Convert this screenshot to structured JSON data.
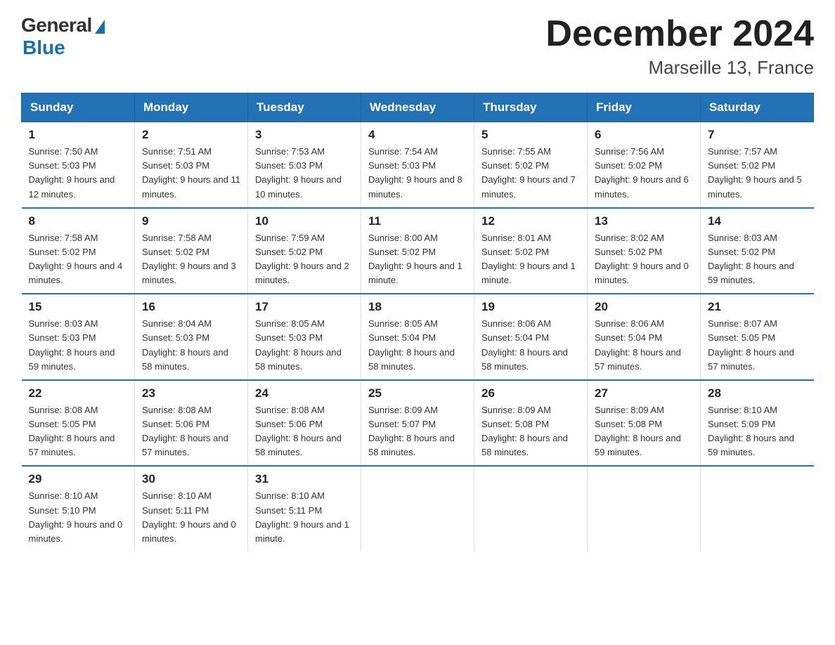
{
  "logo": {
    "general_text": "General",
    "blue_text": "Blue"
  },
  "title": "December 2024",
  "location": "Marseille 13, France",
  "weekdays": [
    "Sunday",
    "Monday",
    "Tuesday",
    "Wednesday",
    "Thursday",
    "Friday",
    "Saturday"
  ],
  "weeks": [
    [
      {
        "day": "1",
        "sunrise": "7:50 AM",
        "sunset": "5:03 PM",
        "daylight": "9 hours and 12 minutes."
      },
      {
        "day": "2",
        "sunrise": "7:51 AM",
        "sunset": "5:03 PM",
        "daylight": "9 hours and 11 minutes."
      },
      {
        "day": "3",
        "sunrise": "7:53 AM",
        "sunset": "5:03 PM",
        "daylight": "9 hours and 10 minutes."
      },
      {
        "day": "4",
        "sunrise": "7:54 AM",
        "sunset": "5:03 PM",
        "daylight": "9 hours and 8 minutes."
      },
      {
        "day": "5",
        "sunrise": "7:55 AM",
        "sunset": "5:02 PM",
        "daylight": "9 hours and 7 minutes."
      },
      {
        "day": "6",
        "sunrise": "7:56 AM",
        "sunset": "5:02 PM",
        "daylight": "9 hours and 6 minutes."
      },
      {
        "day": "7",
        "sunrise": "7:57 AM",
        "sunset": "5:02 PM",
        "daylight": "9 hours and 5 minutes."
      }
    ],
    [
      {
        "day": "8",
        "sunrise": "7:58 AM",
        "sunset": "5:02 PM",
        "daylight": "9 hours and 4 minutes."
      },
      {
        "day": "9",
        "sunrise": "7:58 AM",
        "sunset": "5:02 PM",
        "daylight": "9 hours and 3 minutes."
      },
      {
        "day": "10",
        "sunrise": "7:59 AM",
        "sunset": "5:02 PM",
        "daylight": "9 hours and 2 minutes."
      },
      {
        "day": "11",
        "sunrise": "8:00 AM",
        "sunset": "5:02 PM",
        "daylight": "9 hours and 1 minute."
      },
      {
        "day": "12",
        "sunrise": "8:01 AM",
        "sunset": "5:02 PM",
        "daylight": "9 hours and 1 minute."
      },
      {
        "day": "13",
        "sunrise": "8:02 AM",
        "sunset": "5:02 PM",
        "daylight": "9 hours and 0 minutes."
      },
      {
        "day": "14",
        "sunrise": "8:03 AM",
        "sunset": "5:02 PM",
        "daylight": "8 hours and 59 minutes."
      }
    ],
    [
      {
        "day": "15",
        "sunrise": "8:03 AM",
        "sunset": "5:03 PM",
        "daylight": "8 hours and 59 minutes."
      },
      {
        "day": "16",
        "sunrise": "8:04 AM",
        "sunset": "5:03 PM",
        "daylight": "8 hours and 58 minutes."
      },
      {
        "day": "17",
        "sunrise": "8:05 AM",
        "sunset": "5:03 PM",
        "daylight": "8 hours and 58 minutes."
      },
      {
        "day": "18",
        "sunrise": "8:05 AM",
        "sunset": "5:04 PM",
        "daylight": "8 hours and 58 minutes."
      },
      {
        "day": "19",
        "sunrise": "8:06 AM",
        "sunset": "5:04 PM",
        "daylight": "8 hours and 58 minutes."
      },
      {
        "day": "20",
        "sunrise": "8:06 AM",
        "sunset": "5:04 PM",
        "daylight": "8 hours and 57 minutes."
      },
      {
        "day": "21",
        "sunrise": "8:07 AM",
        "sunset": "5:05 PM",
        "daylight": "8 hours and 57 minutes."
      }
    ],
    [
      {
        "day": "22",
        "sunrise": "8:08 AM",
        "sunset": "5:05 PM",
        "daylight": "8 hours and 57 minutes."
      },
      {
        "day": "23",
        "sunrise": "8:08 AM",
        "sunset": "5:06 PM",
        "daylight": "8 hours and 57 minutes."
      },
      {
        "day": "24",
        "sunrise": "8:08 AM",
        "sunset": "5:06 PM",
        "daylight": "8 hours and 58 minutes."
      },
      {
        "day": "25",
        "sunrise": "8:09 AM",
        "sunset": "5:07 PM",
        "daylight": "8 hours and 58 minutes."
      },
      {
        "day": "26",
        "sunrise": "8:09 AM",
        "sunset": "5:08 PM",
        "daylight": "8 hours and 58 minutes."
      },
      {
        "day": "27",
        "sunrise": "8:09 AM",
        "sunset": "5:08 PM",
        "daylight": "8 hours and 59 minutes."
      },
      {
        "day": "28",
        "sunrise": "8:10 AM",
        "sunset": "5:09 PM",
        "daylight": "8 hours and 59 minutes."
      }
    ],
    [
      {
        "day": "29",
        "sunrise": "8:10 AM",
        "sunset": "5:10 PM",
        "daylight": "9 hours and 0 minutes."
      },
      {
        "day": "30",
        "sunrise": "8:10 AM",
        "sunset": "5:11 PM",
        "daylight": "9 hours and 0 minutes."
      },
      {
        "day": "31",
        "sunrise": "8:10 AM",
        "sunset": "5:11 PM",
        "daylight": "9 hours and 1 minute."
      },
      null,
      null,
      null,
      null
    ]
  ],
  "labels": {
    "sunrise": "Sunrise:",
    "sunset": "Sunset:",
    "daylight": "Daylight:"
  }
}
